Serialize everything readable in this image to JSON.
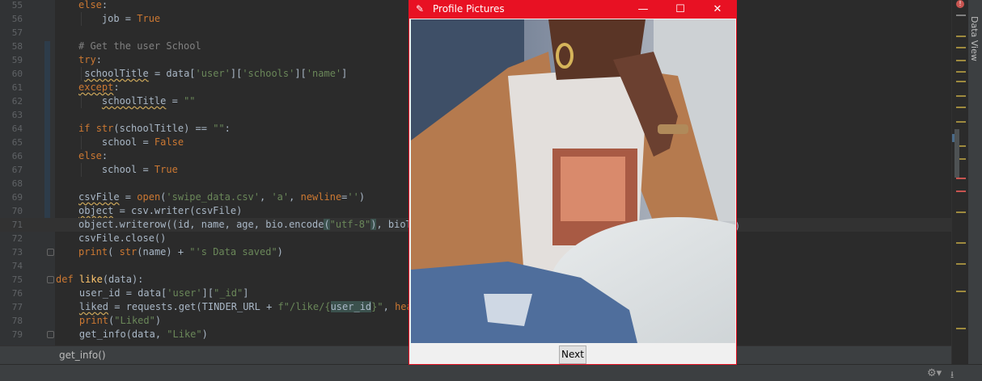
{
  "editor": {
    "lines": [
      {
        "num": "55",
        "html": "<span class=\"kw\">else</span>:"
      },
      {
        "num": "56",
        "html": "    job = <span class=\"kw\">True</span>"
      },
      {
        "num": "57",
        "html": ""
      },
      {
        "num": "58",
        "html": "<span class=\"cmt\"># Get the user School</span>"
      },
      {
        "num": "59",
        "html": "<span class=\"kw\">try</span>:"
      },
      {
        "num": "60",
        "html": " <span class=\"squig\">schoolTitle</span> = data[<span class=\"str\">'user'</span>][<span class=\"str\">'schools'</span>][<span class=\"str\">'name'</span>]"
      },
      {
        "num": "61",
        "html": "<span class=\"kw squig\">except</span>:"
      },
      {
        "num": "62",
        "html": "    <span class=\"squig\">schoolTitle</span> = <span class=\"str\">\"\"</span>"
      },
      {
        "num": "63",
        "html": ""
      },
      {
        "num": "64",
        "html": "<span class=\"kw\">if</span> <span class=\"kw\">str</span>(schoolTitle) == <span class=\"str\">\"\"</span>:"
      },
      {
        "num": "65",
        "html": "    school = <span class=\"kw\">False</span>"
      },
      {
        "num": "66",
        "html": "<span class=\"kw\">else</span>:"
      },
      {
        "num": "67",
        "html": "    school = <span class=\"kw\">True</span>"
      },
      {
        "num": "68",
        "html": ""
      },
      {
        "num": "69",
        "html": "<span class=\"squig\">csvFile</span> = <span class=\"kw\">open</span>(<span class=\"str\">'swipe_data.csv'</span>, <span class=\"str\">'a'</span>, <span class=\"kw\">newline</span>=<span class=\"str\">''</span>)"
      },
      {
        "num": "70",
        "html": "<span class=\"squig\">object</span> = csv.writer(csvFile)"
      },
      {
        "num": "71",
        "html": "object.writerow((id, name, age, bio.encode<span class=\"match\">(</span><span class=\"str\">\"utf-8\"</span><span class=\"match\">)</span>, bioTe"
      },
      {
        "num": "72",
        "html": "csvFile.close()"
      },
      {
        "num": "73",
        "html": "<span class=\"kw\">print</span>( <span class=\"kw\">str</span>(name) + <span class=\"str\">\"'s Data saved\"</span>)"
      },
      {
        "num": "74",
        "html": ""
      },
      {
        "num": "75",
        "html": "<span class=\"kw\">def</span> <span class=\"fn\">like</span>(data):"
      },
      {
        "num": "76",
        "html": "    user_id = data[<span class=\"str\">'user'</span>][<span class=\"str\">\"_id\"</span>]"
      },
      {
        "num": "77",
        "html": "    <span class=\"squig\">liked</span> = requests.get(TINDER_URL + <span class=\"str\">f\"/like/{</span><span class=\"match\">user_id</span><span class=\"str\">}\"</span>, <span class=\"kw\">head</span>"
      },
      {
        "num": "78",
        "html": "    <span class=\"kw\">print</span>(<span class=\"str\">\"Liked\"</span>)"
      },
      {
        "num": "79",
        "html": "    get_info(data, <span class=\"str\">\"Like\"</span>)"
      }
    ],
    "extra_right_text": ")"
  },
  "breadcrumb": {
    "text": "get_info()"
  },
  "side_panel": {
    "label": "Data View"
  },
  "window": {
    "title": "Profile Pictures",
    "minimize": "—",
    "maximize": "☐",
    "close": "✕",
    "next_label": "Next"
  },
  "colors": {
    "titlebar": "#e81123",
    "editor_bg": "#2b2b2b",
    "keyword": "#cc7832",
    "string": "#6a8759"
  }
}
